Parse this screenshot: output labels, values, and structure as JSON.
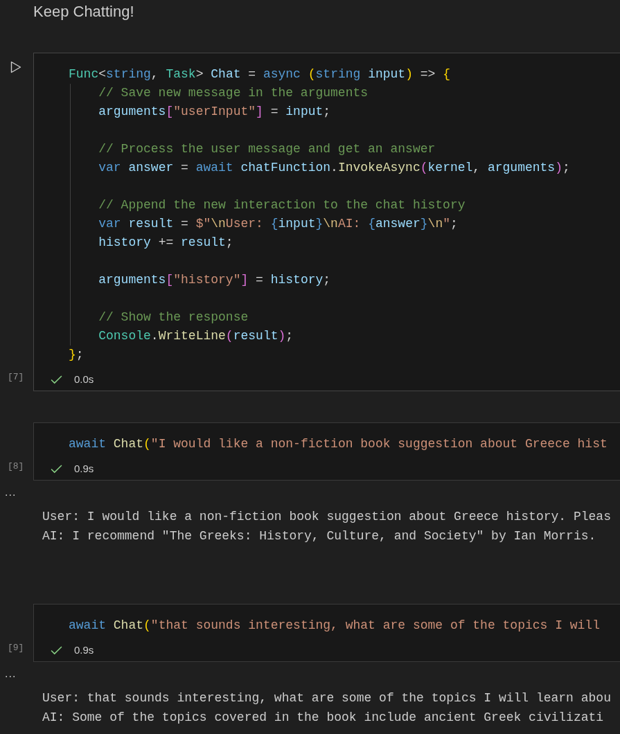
{
  "heading": "Keep Chatting!",
  "cells": [
    {
      "focused": true,
      "count": "[7]",
      "duration": "0.0s",
      "lines": [
        {
          "kind": "code",
          "tokens": [
            {
              "text": "Func",
              "kind": "type"
            },
            {
              "text": "<",
              "kind": "plain"
            },
            {
              "text": "string",
              "kind": "keyword"
            },
            {
              "text": ", ",
              "kind": "plain"
            },
            {
              "text": "Task",
              "kind": "type"
            },
            {
              "text": "> ",
              "kind": "plain"
            },
            {
              "text": "Chat",
              "kind": "variable"
            },
            {
              "text": " = ",
              "kind": "plain"
            },
            {
              "text": "async ",
              "kind": "keyword"
            },
            {
              "text": "(",
              "kind": "bracket1"
            },
            {
              "text": "string ",
              "kind": "keyword"
            },
            {
              "text": "input",
              "kind": "variable"
            },
            {
              "text": ")",
              "kind": "bracket1"
            },
            {
              "text": " => ",
              "kind": "plain"
            },
            {
              "text": "{",
              "kind": "bracket1"
            }
          ]
        },
        {
          "kind": "code",
          "tokens": [
            {
              "text": "    // Save new message in the arguments",
              "kind": "comment"
            }
          ]
        },
        {
          "kind": "code",
          "tokens": [
            {
              "text": "    arguments",
              "kind": "variable"
            },
            {
              "text": "[",
              "kind": "bracket2"
            },
            {
              "text": "\"userInput\"",
              "kind": "string"
            },
            {
              "text": "]",
              "kind": "bracket2"
            },
            {
              "text": " = ",
              "kind": "plain"
            },
            {
              "text": "input",
              "kind": "variable"
            },
            {
              "text": ";",
              "kind": "plain"
            }
          ]
        },
        {
          "kind": "blank"
        },
        {
          "kind": "code",
          "tokens": [
            {
              "text": "    // Process the user message and get an answer",
              "kind": "comment"
            }
          ]
        },
        {
          "kind": "code",
          "tokens": [
            {
              "text": "    var ",
              "kind": "keyword"
            },
            {
              "text": "answer",
              "kind": "variable"
            },
            {
              "text": " = ",
              "kind": "plain"
            },
            {
              "text": "await ",
              "kind": "keyword"
            },
            {
              "text": "chatFunction",
              "kind": "variable"
            },
            {
              "text": ".",
              "kind": "plain"
            },
            {
              "text": "InvokeAsync",
              "kind": "func"
            },
            {
              "text": "(",
              "kind": "bracket2"
            },
            {
              "text": "kernel",
              "kind": "variable"
            },
            {
              "text": ", ",
              "kind": "plain"
            },
            {
              "text": "arguments",
              "kind": "variable"
            },
            {
              "text": ")",
              "kind": "bracket2"
            },
            {
              "text": ";",
              "kind": "plain"
            }
          ]
        },
        {
          "kind": "blank"
        },
        {
          "kind": "code",
          "tokens": [
            {
              "text": "    // Append the new interaction to the chat history",
              "kind": "comment"
            }
          ]
        },
        {
          "kind": "code",
          "tokens": [
            {
              "text": "    var ",
              "kind": "keyword"
            },
            {
              "text": "result",
              "kind": "variable"
            },
            {
              "text": " = ",
              "kind": "plain"
            },
            {
              "text": "$\"",
              "kind": "string"
            },
            {
              "text": "\\n",
              "kind": "escape"
            },
            {
              "text": "User: ",
              "kind": "string"
            },
            {
              "text": "{",
              "kind": "interp"
            },
            {
              "text": "input",
              "kind": "variable"
            },
            {
              "text": "}",
              "kind": "interp"
            },
            {
              "text": "\\n",
              "kind": "escape"
            },
            {
              "text": "AI: ",
              "kind": "string"
            },
            {
              "text": "{",
              "kind": "interp"
            },
            {
              "text": "answer",
              "kind": "variable"
            },
            {
              "text": "}",
              "kind": "interp"
            },
            {
              "text": "\\n",
              "kind": "escape"
            },
            {
              "text": "\"",
              "kind": "string"
            },
            {
              "text": ";",
              "kind": "plain"
            }
          ]
        },
        {
          "kind": "code",
          "tokens": [
            {
              "text": "    history",
              "kind": "variable"
            },
            {
              "text": " += ",
              "kind": "plain"
            },
            {
              "text": "result",
              "kind": "variable"
            },
            {
              "text": ";",
              "kind": "plain"
            }
          ]
        },
        {
          "kind": "blank"
        },
        {
          "kind": "code",
          "tokens": [
            {
              "text": "    arguments",
              "kind": "variable"
            },
            {
              "text": "[",
              "kind": "bracket2"
            },
            {
              "text": "\"history\"",
              "kind": "string"
            },
            {
              "text": "]",
              "kind": "bracket2"
            },
            {
              "text": " = ",
              "kind": "plain"
            },
            {
              "text": "history",
              "kind": "variable"
            },
            {
              "text": ";",
              "kind": "plain"
            }
          ]
        },
        {
          "kind": "blank"
        },
        {
          "kind": "code",
          "tokens": [
            {
              "text": "    // Show the response",
              "kind": "comment"
            }
          ]
        },
        {
          "kind": "code",
          "tokens": [
            {
              "text": "    Console",
              "kind": "type"
            },
            {
              "text": ".",
              "kind": "plain"
            },
            {
              "text": "WriteLine",
              "kind": "func"
            },
            {
              "text": "(",
              "kind": "bracket2"
            },
            {
              "text": "result",
              "kind": "variable"
            },
            {
              "text": ")",
              "kind": "bracket2"
            },
            {
              "text": ";",
              "kind": "plain"
            }
          ]
        },
        {
          "kind": "code",
          "tokens": [
            {
              "text": "}",
              "kind": "bracket1"
            },
            {
              "text": ";",
              "kind": "plain"
            }
          ]
        }
      ]
    },
    {
      "focused": false,
      "count": "[8]",
      "duration": "0.9s",
      "lines": [
        {
          "kind": "code",
          "tokens": [
            {
              "text": "await ",
              "kind": "keyword"
            },
            {
              "text": "Chat",
              "kind": "func"
            },
            {
              "text": "(",
              "kind": "bracket1"
            },
            {
              "text": "\"I would like a non-fiction book suggestion about Greece hist",
              "kind": "string"
            }
          ]
        }
      ],
      "output": {
        "more": "...",
        "lines": [
          "User: I would like a non-fiction book suggestion about Greece history. Pleas",
          "AI: I recommend \"The Greeks: History, Culture, and Society\" by Ian Morris."
        ]
      }
    },
    {
      "focused": false,
      "count": "[9]",
      "duration": "0.9s",
      "lines": [
        {
          "kind": "code",
          "tokens": [
            {
              "text": "await ",
              "kind": "keyword"
            },
            {
              "text": "Chat",
              "kind": "func"
            },
            {
              "text": "(",
              "kind": "bracket1"
            },
            {
              "text": "\"that sounds interesting, what are some of the topics I will",
              "kind": "string"
            }
          ]
        }
      ],
      "output": {
        "more": "...",
        "lines": [
          "User: that sounds interesting, what are some of the topics I will learn abou",
          "AI: Some of the topics covered in the book include ancient Greek civilizati"
        ]
      }
    }
  ]
}
